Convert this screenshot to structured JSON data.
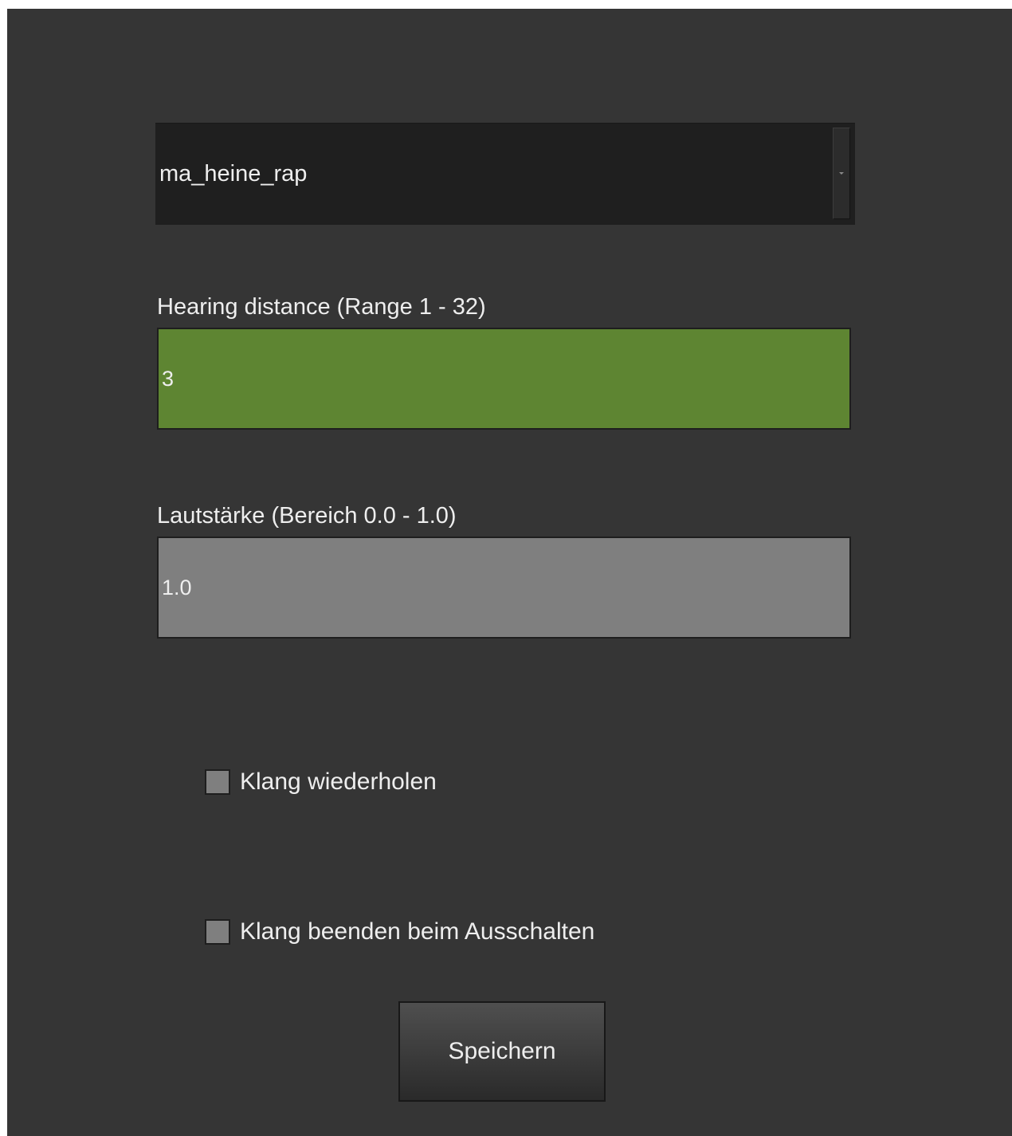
{
  "dropdown": {
    "selected": "ma_heine_rap"
  },
  "hearing_distance": {
    "label": "Hearing distance (Range 1 - 32)",
    "value": "3"
  },
  "volume": {
    "label": "Lautstärke (Bereich 0.0 - 1.0)",
    "value": "1.0"
  },
  "checkboxes": [
    {
      "label": "Klang wiederholen",
      "checked": false
    },
    {
      "label": "Klang beenden beim Ausschalten",
      "checked": false
    }
  ],
  "save_button": {
    "label": "Speichern"
  },
  "colors": {
    "background": "#353535",
    "dropdown_bg": "#1f1f1f",
    "valid_field": "#5e8532",
    "neutral_field": "#7f7f7f",
    "text": "#eeeeee"
  }
}
